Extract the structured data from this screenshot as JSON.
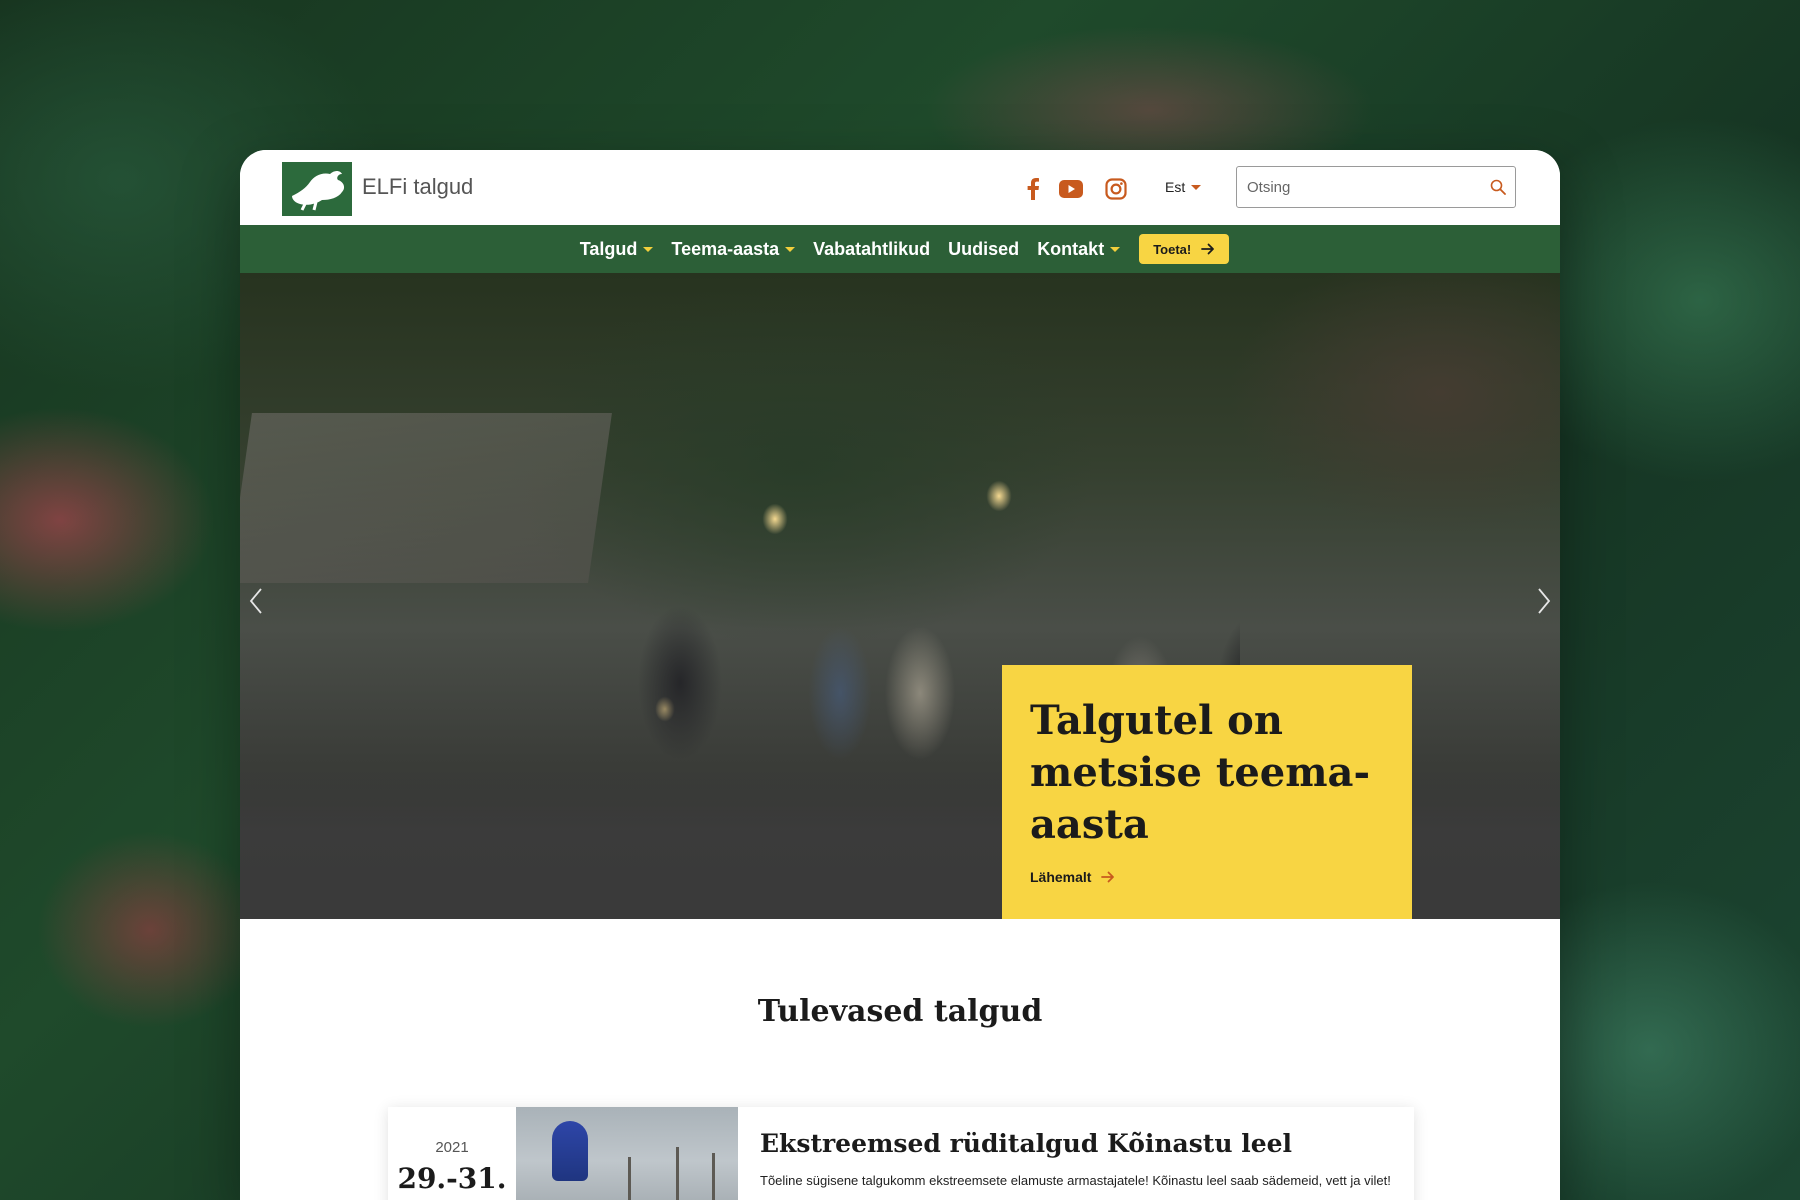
{
  "header": {
    "site_title": "ELFi talgud",
    "language": "Est",
    "search_placeholder": "Otsing"
  },
  "social": [
    {
      "icon": "facebook-icon"
    },
    {
      "icon": "youtube-icon"
    },
    {
      "icon": "instagram-icon"
    }
  ],
  "nav": {
    "items": [
      {
        "label": "Talgud",
        "has_dropdown": true
      },
      {
        "label": "Teema-aasta",
        "has_dropdown": true
      },
      {
        "label": "Vabatahtlikud",
        "has_dropdown": false
      },
      {
        "label": "Uudised",
        "has_dropdown": false
      },
      {
        "label": "Kontakt",
        "has_dropdown": true
      }
    ],
    "donate_label": "Toeta!"
  },
  "hero": {
    "title": "Talgutel on metsise teema-aasta",
    "link_label": "Lähemalt"
  },
  "upcoming": {
    "title": "Tulevased talgud",
    "events": [
      {
        "year": "2021",
        "days": "29.-31.",
        "title": "Ekstreemsed rüditalgud Kõinastu leel",
        "description": "Tõeline sügisene talgukomm ekstreemsete elamuste armastajatele! Kõinastu leel saab sädemeid, vett ja vilet!"
      }
    ]
  },
  "colors": {
    "green": "#2c5f37",
    "logo_green": "#2c6a3c",
    "yellow": "#f8d543",
    "social_orange": "#c85a1e"
  }
}
